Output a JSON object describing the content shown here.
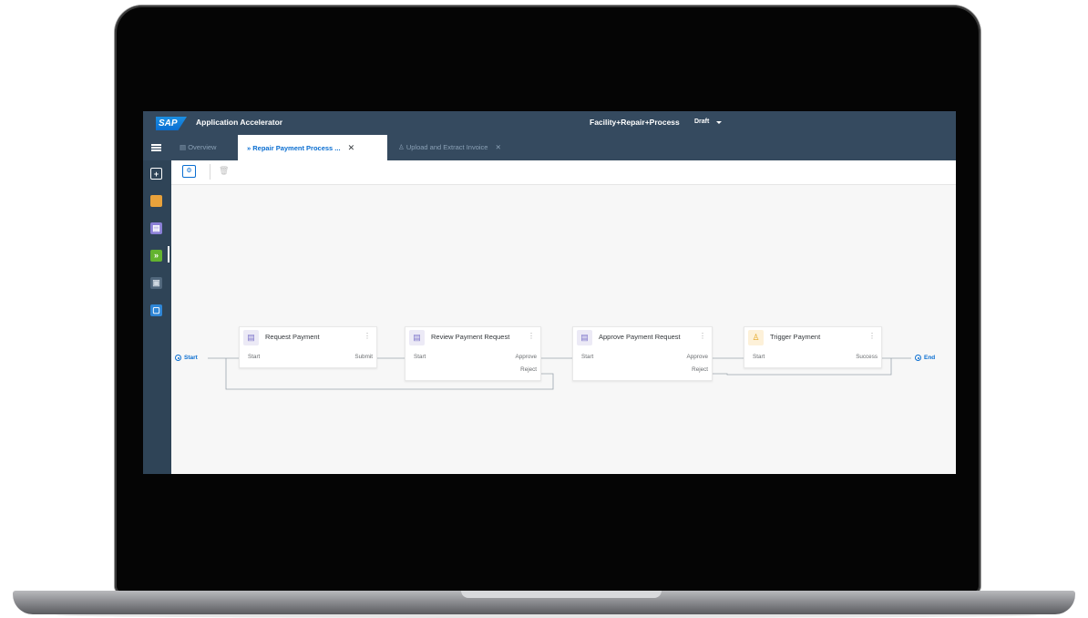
{
  "shell": {
    "logo": "SAP",
    "app_title": "Application Accelerator",
    "project_title": "Facility+Repair+Process",
    "status": "Draft"
  },
  "tabs": [
    {
      "label": "Overview",
      "icon": "overview-icon"
    },
    {
      "label": "Repair Payment Process ...",
      "icon": "process-chevrons-icon",
      "close": "✕"
    },
    {
      "label": "Upload and Extract Invoice",
      "icon": "automation-icon",
      "close": "✕"
    }
  ],
  "sidebar": {
    "items": [
      {
        "icon": "add-icon",
        "color": "#ffffff"
      },
      {
        "icon": "decision-icon",
        "color": "#e9a23b"
      },
      {
        "icon": "form-icon",
        "color": "#8a7fd6"
      },
      {
        "icon": "process-icon",
        "color": "#63b32f"
      },
      {
        "icon": "data-type-icon",
        "color": "#8ea3b8"
      },
      {
        "icon": "file-icon",
        "color": "#2f86d6"
      }
    ]
  },
  "toolbar": {
    "settings_icon": "settings-icon",
    "delete_icon": "trash-icon"
  },
  "flow": {
    "start_label": "Start",
    "end_label": "End",
    "nodes": [
      {
        "title": "Request Payment",
        "type": "form",
        "ports_in": [
          "Start"
        ],
        "ports_out": [
          "Submit"
        ]
      },
      {
        "title": "Review Payment Request",
        "type": "form",
        "ports_in": [
          "Start"
        ],
        "ports_out": [
          "Approve",
          "Reject"
        ]
      },
      {
        "title": "Approve Payment Request",
        "type": "form",
        "ports_in": [
          "Start"
        ],
        "ports_out": [
          "Approve",
          "Reject"
        ]
      },
      {
        "title": "Trigger Payment",
        "type": "automation",
        "ports_in": [
          "Start"
        ],
        "ports_out": [
          "Success"
        ]
      }
    ]
  },
  "colors": {
    "shell": "#354a5f",
    "accent": "#0a6ed1"
  }
}
